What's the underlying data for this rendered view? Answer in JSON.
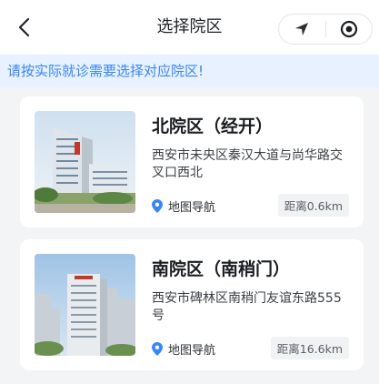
{
  "header": {
    "title": "选择院区",
    "back_icon": "chevron-left-icon",
    "capsule": {
      "left_icon": "location-arrow-icon",
      "right_icon": "target-icon"
    }
  },
  "notice": {
    "text": "请按实际就诊需要选择对应院区!"
  },
  "campuses": [
    {
      "name": "北院区（经开）",
      "address": "西安市未央区秦汉大道与尚华路交叉口西北",
      "nav_label": "地图导航",
      "distance": "距离0.6km"
    },
    {
      "name": "南院区（南稍门）",
      "address": "西安市碑林区南稍门友谊东路555号",
      "nav_label": "地图导航",
      "distance": "距离16.6km"
    }
  ],
  "colors": {
    "accent": "#3a86f5",
    "notice_bg": "#e7f1ff",
    "page_bg": "#f3f4f6"
  }
}
